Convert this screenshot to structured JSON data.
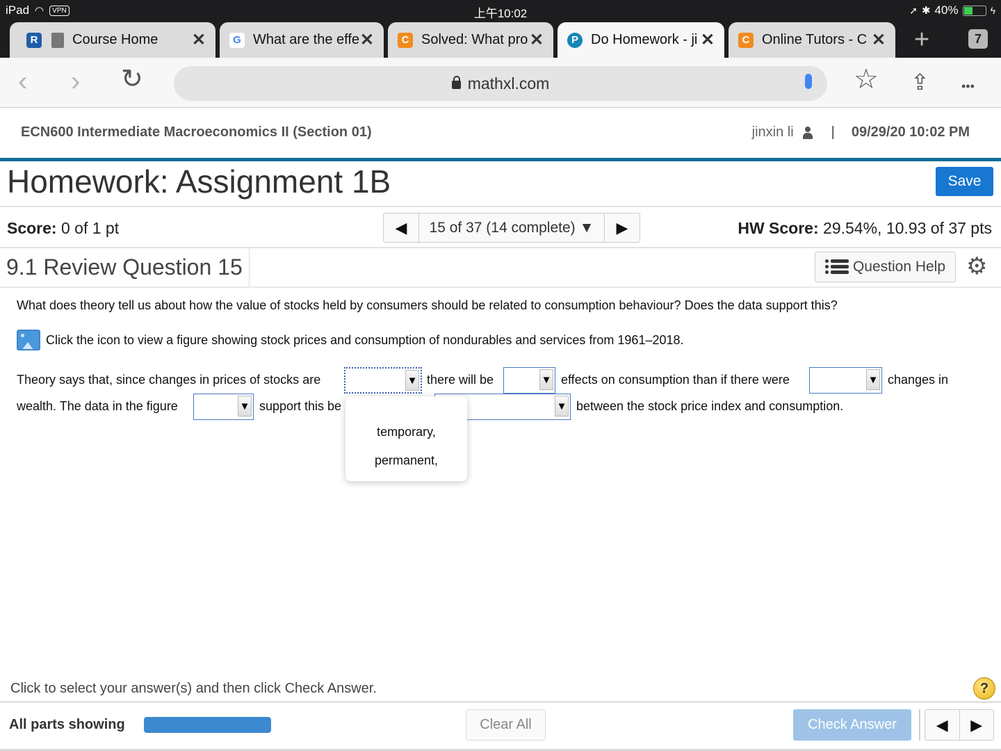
{
  "status_bar": {
    "device": "iPad",
    "vpn": "VPN",
    "time": "上午10:02",
    "battery_text": "40%",
    "battery_level_percent": 40
  },
  "browser": {
    "tabs": [
      {
        "favicon": "book-icon",
        "title": "Course Home",
        "close": "✕",
        "active": false
      },
      {
        "favicon": "google-icon",
        "favicon_text": "G",
        "title": "What are the effe",
        "close": "✕",
        "active": false
      },
      {
        "favicon": "chegg-icon",
        "favicon_text": "C",
        "title": "Solved: What pro",
        "close": "✕",
        "active": false
      },
      {
        "favicon": "pearson-icon",
        "favicon_text": "P",
        "title": "Do Homework - ji",
        "close": "✕",
        "active": true
      },
      {
        "favicon": "chegg-icon",
        "favicon_text": "C",
        "title": "Online Tutors - C",
        "close": "✕",
        "active": false
      }
    ],
    "pinned_favicon_text": "R",
    "new_tab": "+",
    "tab_count": "7",
    "url": "mathxl.com",
    "back": "‹",
    "forward": "›",
    "reload": "↻",
    "bookmark": "☆",
    "share": "⇪",
    "more": "•••"
  },
  "course": {
    "name": "ECN600 Intermediate Macroeconomics II (Section 01)",
    "user": "jinxin li",
    "separator": "|",
    "datetime": "09/29/20 10:02 PM"
  },
  "homework": {
    "title": "Homework: Assignment 1B",
    "save_label": "Save",
    "score_label": "Score:",
    "score_value": "0 of 1 pt",
    "question_nav": {
      "prev": "◀",
      "current": "15 of 37 (14 complete)",
      "caret": "▼",
      "next": "▶"
    },
    "hw_score_label": "HW Score:",
    "hw_score_value": "29.54%, 10.93 of 37 pts"
  },
  "question": {
    "title": "9.1 Review Question 15",
    "help_label": "Question Help",
    "prompt": "What does theory tell us about how the value of stocks held by consumers should be related to consumption behaviour? Does the data support this?",
    "figure_text": "Click the icon to view a figure showing stock prices and consumption of nondurables and services from 1961–2018.",
    "sentence": {
      "part1": "Theory says that, since changes in prices of stocks are",
      "part2": "there will be",
      "part3": "effects on consumption than if there were",
      "part4": "changes in",
      "part5": "wealth. The data in the figure",
      "part6": "support this be",
      "part7": "between the stock price index and consumption."
    },
    "dropdowns": [
      {
        "value": "",
        "open": true
      },
      {
        "value": ""
      },
      {
        "value": ""
      },
      {
        "value": ""
      },
      {
        "value": ""
      }
    ],
    "dropdown_arrow": "▼",
    "open_dropdown_options": [
      "temporary,",
      "permanent,"
    ]
  },
  "footer": {
    "instructions": "Click to select your answer(s) and then click Check Answer.",
    "help_icon": "?",
    "parts_label": "All parts showing",
    "parts_progress_percent": 100,
    "clear_all": "Clear All",
    "check_answer": "Check Answer",
    "prev": "◀",
    "next": "▶"
  }
}
